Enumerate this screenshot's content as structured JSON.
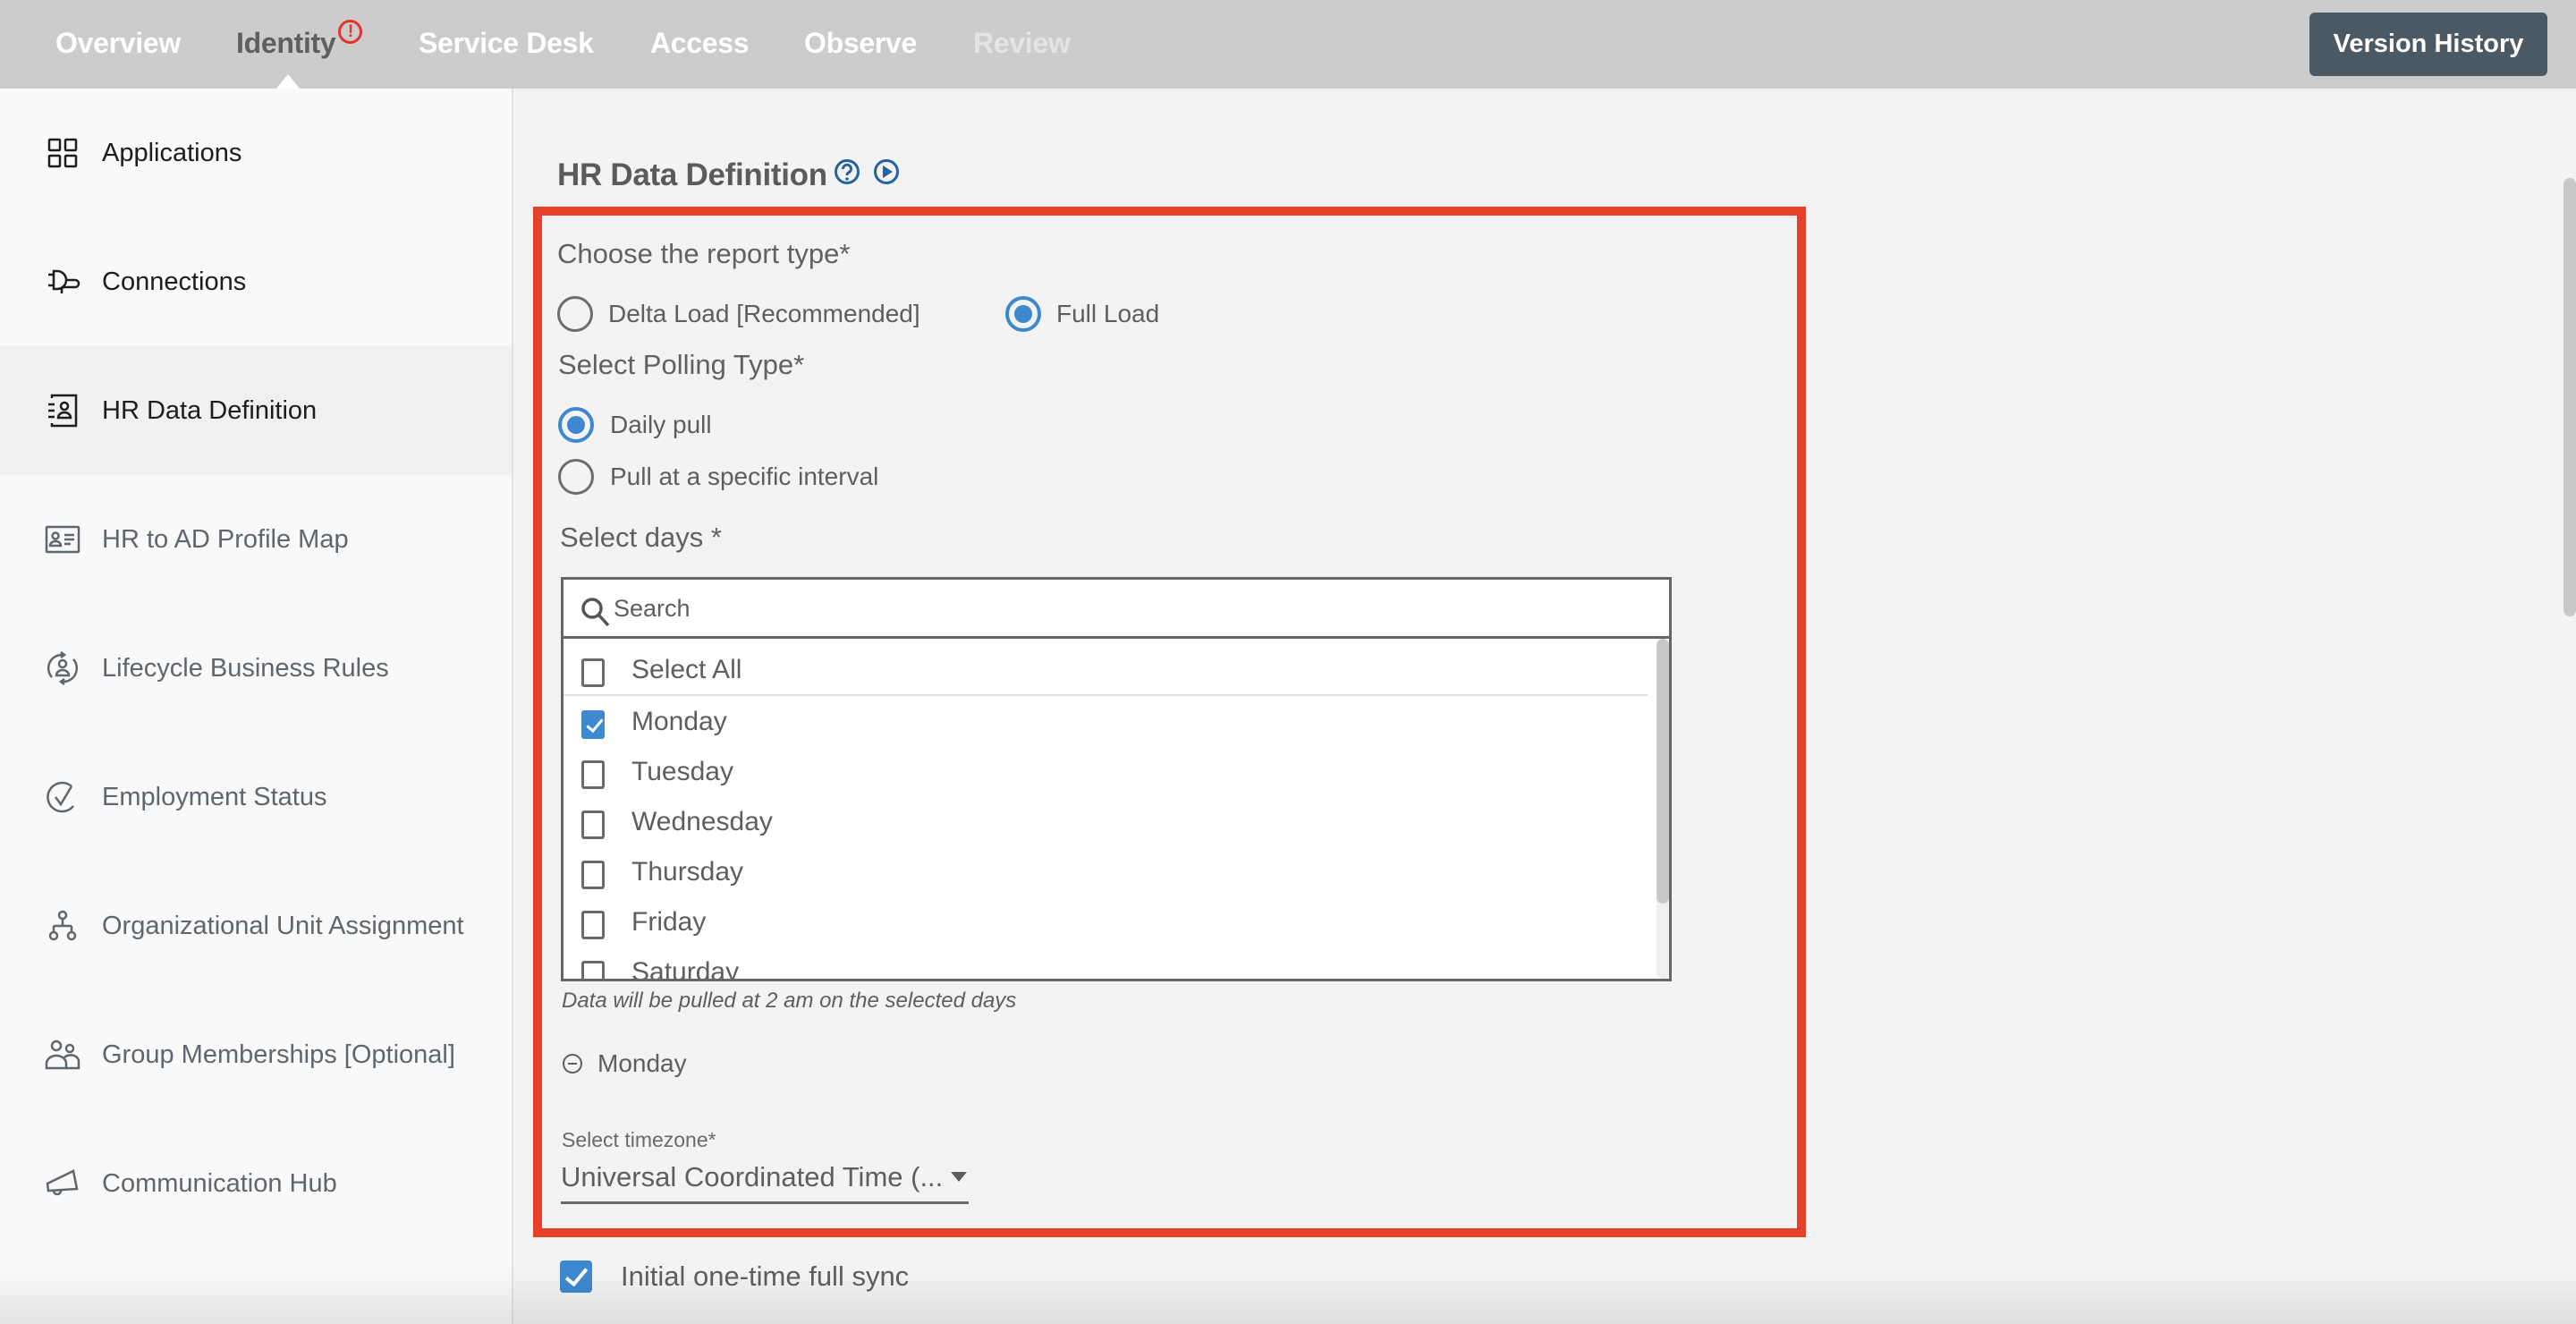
{
  "topnav": {
    "tabs": [
      {
        "label": "Overview",
        "state": "normal"
      },
      {
        "label": "Identity",
        "state": "active",
        "badge": "!"
      },
      {
        "label": "Service Desk",
        "state": "normal"
      },
      {
        "label": "Access",
        "state": "normal"
      },
      {
        "label": "Observe",
        "state": "normal"
      },
      {
        "label": "Review",
        "state": "disabled"
      }
    ],
    "version_history_label": "Version History"
  },
  "sidebar": {
    "items": [
      {
        "label": "Applications",
        "icon": "grid-icon"
      },
      {
        "label": "Connections",
        "icon": "plug-icon"
      },
      {
        "label": "HR Data Definition",
        "icon": "contact-book-icon",
        "active": true
      },
      {
        "label": "HR to AD Profile Map",
        "icon": "id-card-icon"
      },
      {
        "label": "Lifecycle Business Rules",
        "icon": "user-cycle-icon"
      },
      {
        "label": "Employment Status",
        "icon": "check-circle-icon"
      },
      {
        "label": "Organizational Unit Assignment",
        "icon": "org-chart-icon"
      },
      {
        "label": "Group Memberships [Optional]",
        "icon": "users-icon"
      },
      {
        "label": "Communication Hub",
        "icon": "megaphone-icon"
      }
    ]
  },
  "main": {
    "title": "HR Data Definition",
    "report_type": {
      "label": "Choose the report type*",
      "options": [
        {
          "label": "Delta Load [Recommended]",
          "checked": false
        },
        {
          "label": "Full Load",
          "checked": true
        }
      ]
    },
    "polling_type": {
      "label": "Select Polling Type*",
      "options": [
        {
          "label": "Daily pull",
          "checked": true
        },
        {
          "label": "Pull at a specific interval",
          "checked": false
        }
      ]
    },
    "select_days": {
      "label": "Select days *",
      "search_placeholder": "Search",
      "search_value": "",
      "options": [
        {
          "label": "Select All",
          "checked": false
        },
        {
          "label": "Monday",
          "checked": true
        },
        {
          "label": "Tuesday",
          "checked": false
        },
        {
          "label": "Wednesday",
          "checked": false
        },
        {
          "label": "Thursday",
          "checked": false
        },
        {
          "label": "Friday",
          "checked": false
        },
        {
          "label": "Saturday",
          "checked": false
        }
      ],
      "hint": "Data will be pulled at 2 am on the selected days",
      "selected_chips": [
        "Monday"
      ]
    },
    "timezone": {
      "label": "Select timezone*",
      "value": "Universal Coordinated Time (..."
    },
    "initial_sync": {
      "label": "Initial one-time full sync",
      "checked": true
    }
  },
  "colors": {
    "accent": "#3e88cf",
    "highlight_box": "#e8412a",
    "badge": "#e5332a",
    "version_button": "#4a5964",
    "topbar": "#cccccc"
  }
}
